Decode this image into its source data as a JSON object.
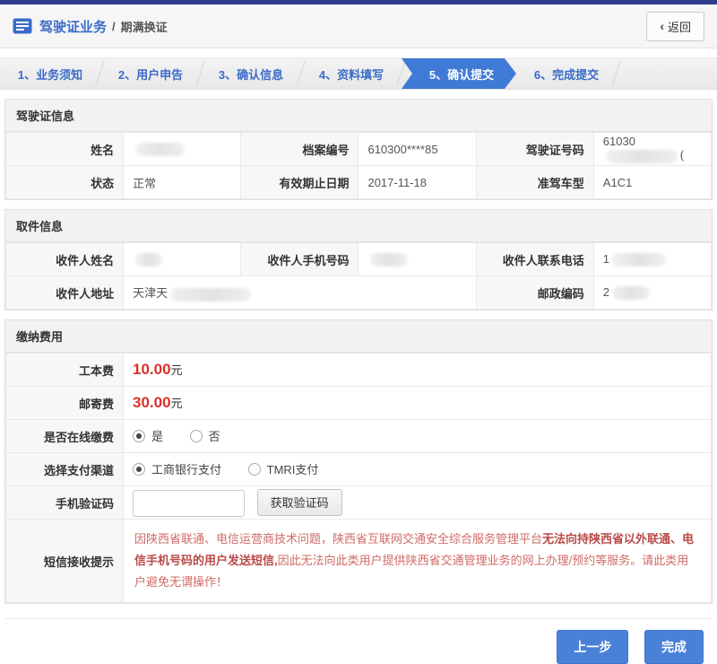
{
  "header": {
    "title": "驾驶证业务",
    "divider": "/",
    "subtitle": "期满换证",
    "back_icon": "‹",
    "back": "返回"
  },
  "steps": {
    "items": [
      "1、业务须知",
      "2、用户申告",
      "3、确认信息",
      "4、资料填写",
      "5、确认提交",
      "6、完成提交"
    ],
    "active_index": 4
  },
  "license": {
    "title": "驾驶证信息",
    "row1": {
      "name_label": "姓名",
      "name_redacted": true,
      "file_no_label": "档案编号",
      "file_no": "610300****85",
      "license_no_label": "驾驶证号码",
      "license_no_prefix": "61030",
      "license_no_redacted": true,
      "license_no_suffix": "("
    },
    "row2": {
      "status_label": "状态",
      "status": "正常",
      "expiry_label": "有效期止日期",
      "expiry": "2017-11-18",
      "class_label": "准驾车型",
      "class": "A1C1"
    }
  },
  "pickup": {
    "title": "取件信息",
    "row1": {
      "name_label": "收件人姓名",
      "name_redacted": true,
      "mobile_label": "收件人手机号码",
      "mobile_redacted": true,
      "tel_label": "收件人联系电话",
      "tel_prefix": "1",
      "tel_redacted": true
    },
    "row2": {
      "address_label": "收件人地址",
      "address_prefix": "天津天",
      "address_redacted": true,
      "postal_label": "邮政编码",
      "postal_prefix": "2",
      "postal_redacted": true
    }
  },
  "payment": {
    "title": "缴纳费用",
    "production_fee": {
      "label": "工本费",
      "amount": "10.00",
      "unit": "元"
    },
    "postage_fee": {
      "label": "邮寄费",
      "amount": "30.00",
      "unit": "元"
    },
    "online": {
      "label": "是否在线缴费",
      "yes": "是",
      "no": "否",
      "selected": "是"
    },
    "channel": {
      "label": "选择支付渠道",
      "opt1": "工商银行支付",
      "opt2": "TMRI支付",
      "selected": "工商银行支付"
    },
    "sms": {
      "label": "手机验证码",
      "input_value": "",
      "button": "获取验证码"
    },
    "notice": {
      "label": "短信接收提示",
      "part1": "因陕西省联通、电信运营商技术问题，陕西省互联网交通安全综合服务管理平台",
      "bold": "无法向持陕西省以外联通、电信手机号码的用户发送短信,",
      "part2": "因此无法向此类用户提供陕西省交通管理业务的网上办理/预约等服务。请此类用户避免无谓操作！"
    }
  },
  "footer": {
    "prev": "上一步",
    "finish": "完成"
  },
  "colors": {
    "topbar_navy": "#2e3c8e",
    "accent_blue": "#3a6bc8",
    "active_step_blue": "#3f7ad6",
    "button_blue": "#4a81d8",
    "price_red": "#d9302c",
    "notice_red": "#cf6b66"
  }
}
